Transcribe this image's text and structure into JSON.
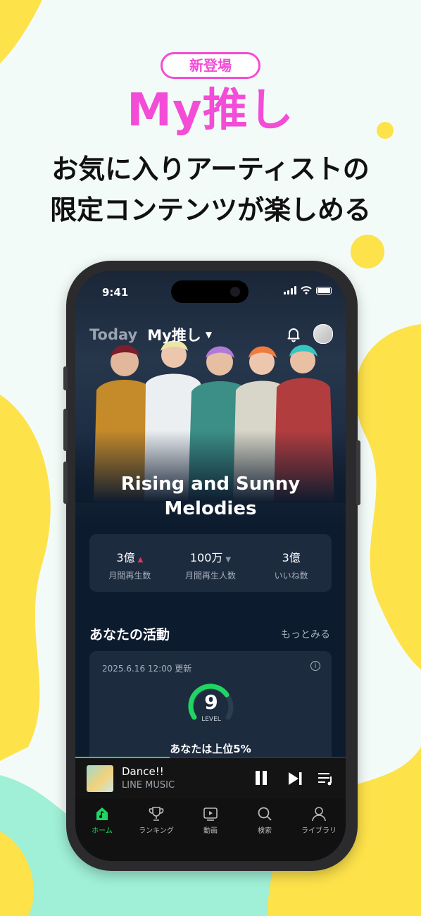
{
  "promo": {
    "badge": "新登場",
    "headline": "My推し",
    "sub_line1": "お気に入りアーティストの",
    "sub_line2": "限定コンテンツが楽しめる"
  },
  "colors": {
    "accent_pink": "#f34cd6",
    "brand_green": "#1ed660",
    "bg_yellow": "#fde24a",
    "bg_mint": "#9ff0d6"
  },
  "status_bar": {
    "time": "9:41"
  },
  "app_header": {
    "tab_today": "Today",
    "tab_my": "My推し",
    "icons": [
      "chevron-down-icon",
      "bell-icon",
      "avatar"
    ]
  },
  "hero": {
    "title_line1": "Rising and Sunny",
    "title_line2": "Melodies"
  },
  "stats": [
    {
      "value": "3億",
      "trend": "up",
      "label": "月間再生数"
    },
    {
      "value": "100万",
      "trend": "down",
      "label": "月間再生人数"
    },
    {
      "value": "3億",
      "trend": "",
      "label": "いいね数"
    }
  ],
  "activity": {
    "title": "あなたの活動",
    "more": "もっとみる",
    "updated": "2025.6.16 12:00 更新",
    "level": "9",
    "level_label": "LEVEL",
    "rank_text": "あなたは上位5%"
  },
  "player": {
    "song": "Dance!!",
    "artist": "LINE MUSIC",
    "progress": 0.35
  },
  "tabs": [
    {
      "label": "ホーム",
      "icon": "home-icon",
      "active": true
    },
    {
      "label": "ランキング",
      "icon": "trophy-icon",
      "active": false
    },
    {
      "label": "動画",
      "icon": "video-icon",
      "active": false
    },
    {
      "label": "検索",
      "icon": "search-icon",
      "active": false
    },
    {
      "label": "ライブラリ",
      "icon": "user-icon",
      "active": false
    }
  ]
}
